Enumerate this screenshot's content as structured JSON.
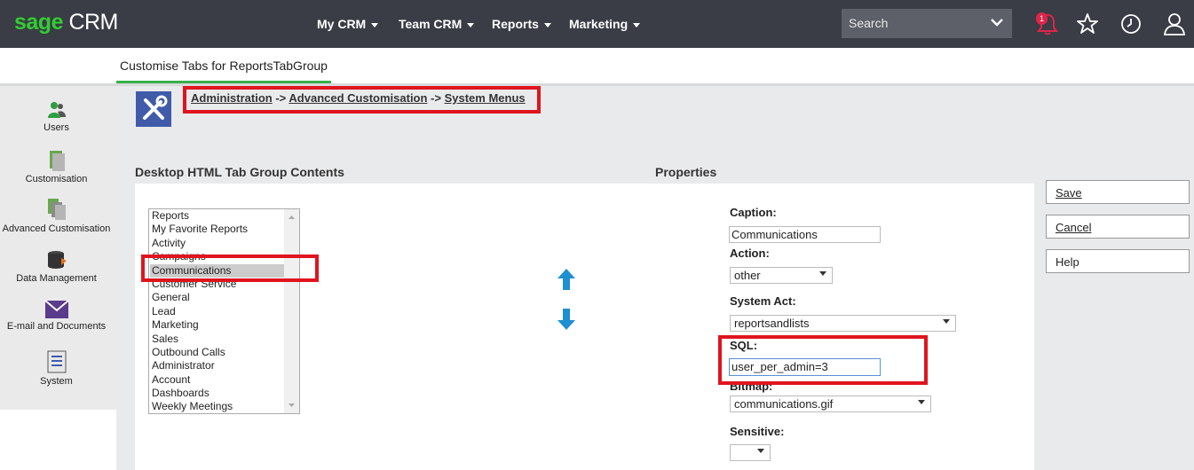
{
  "app": {
    "brand_sage": "sage",
    "brand_crm": "CRM"
  },
  "nav": {
    "my_crm": "My CRM",
    "team_crm": "Team CRM",
    "reports": "Reports",
    "marketing": "Marketing"
  },
  "search": {
    "placeholder": "Search"
  },
  "notifications": {
    "count": "1"
  },
  "tab": {
    "label": "Customise Tabs for ReportsTabGroup"
  },
  "sidebar": {
    "items": [
      {
        "label": "Users",
        "icon": "users-icon"
      },
      {
        "label": "Customisation",
        "icon": "customisation-icon"
      },
      {
        "label": "Advanced Customisation",
        "icon": "advanced-customisation-icon"
      },
      {
        "label": "Data Management",
        "icon": "database-icon"
      },
      {
        "label": "E-mail and Documents",
        "icon": "envelope-icon"
      },
      {
        "label": "System",
        "icon": "system-icon"
      }
    ]
  },
  "breadcrumb": {
    "item1": "Administration",
    "sep1": " -> ",
    "item2": "Advanced Customisation",
    "sep2": " -> ",
    "item3": "System Menus"
  },
  "sections": {
    "left_title": "Desktop HTML Tab Group Contents",
    "right_title": "Properties"
  },
  "tab_list": {
    "items": [
      "Reports",
      "My Favorite Reports",
      "Activity",
      "Campaigns",
      "Communications",
      "Customer Service",
      "General",
      "Lead",
      "Marketing",
      "Sales",
      "Outbound Calls",
      "Administrator",
      "Account",
      "Dashboards",
      "Weekly Meetings"
    ],
    "selected": "Communications"
  },
  "properties": {
    "caption_label": "Caption:",
    "caption_value": "Communications",
    "action_label": "Action:",
    "action_value": "other",
    "system_act_label": "System Act:",
    "system_act_value": "reportsandlists",
    "sql_label": "SQL:",
    "sql_value": "user_per_admin=3",
    "bitmap_label": "Bitmap:",
    "bitmap_value": "communications.gif",
    "sensitive_label": "Sensitive:",
    "sensitive_value": ""
  },
  "buttons": {
    "save": "Save",
    "cancel": "Cancel",
    "help": "Help"
  },
  "colors": {
    "topbar": "#3a3d45",
    "brand_green": "#33cc33",
    "highlight_red": "#e0141e",
    "arrow_blue": "#1e8fd0",
    "admin_icon_bg": "#3f5ba9"
  }
}
